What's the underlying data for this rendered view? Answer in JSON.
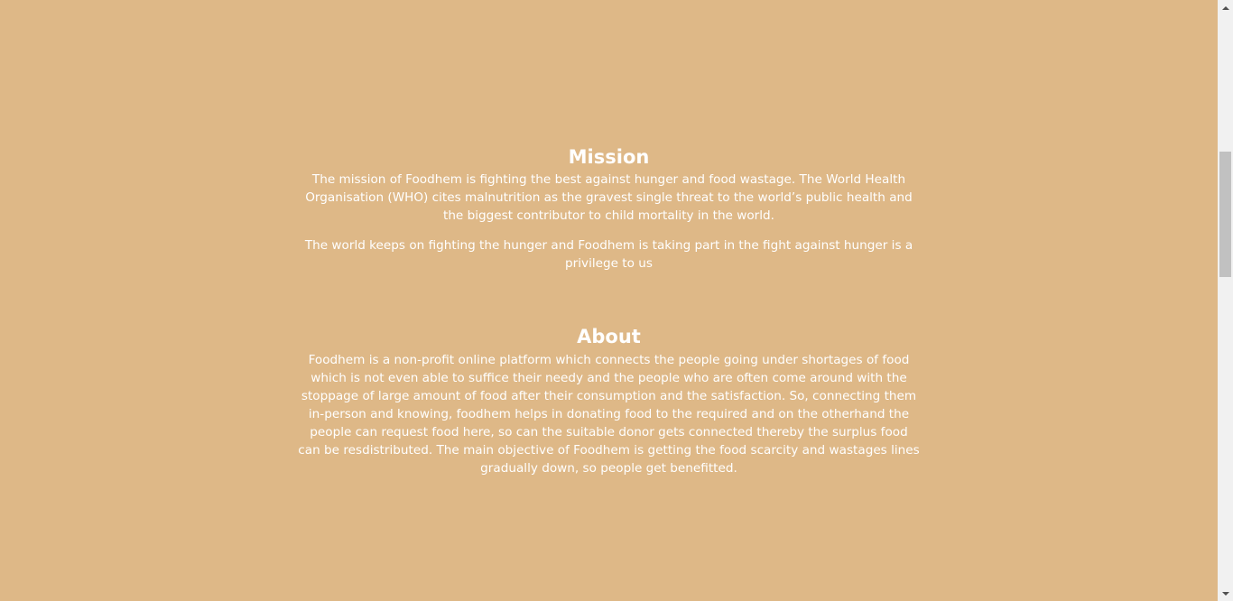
{
  "colors": {
    "background": "#deb887",
    "text": "#ffffff",
    "scrollbar_track": "#f1f1f1",
    "scrollbar_thumb": "#c1c1c1"
  },
  "mission": {
    "heading": "Mission",
    "paragraph_1": "The mission of Foodhem is fighting the best against hunger and food wastage. The World Health Organisation (WHO) cites malnutrition as the gravest single threat to the world’s public health and the biggest contributor to child mortality in the world.",
    "paragraph_2": "The world keeps on fighting the hunger and Foodhem is taking part in the fight against hunger is a privilege to us"
  },
  "about": {
    "heading": "About",
    "paragraph": "Foodhem is a non-profit online platform which connects the people going under shortages of food which is not even able to suffice their needy and the people who are often come around with the stoppage of large amount of food after their consumption and the satisfaction. So, connecting them in-person and knowing, foodhem helps in donating food to the required and on the otherhand the people can request food here, so can the suitable donor gets connected thereby the surplus food can be resdistributed. The main objective of Foodhem is getting the food scarcity and wastages lines gradually down, so people get benefitted."
  },
  "scrollbar": {
    "up_icon": "chevron-up-icon",
    "down_icon": "chevron-down-icon"
  }
}
